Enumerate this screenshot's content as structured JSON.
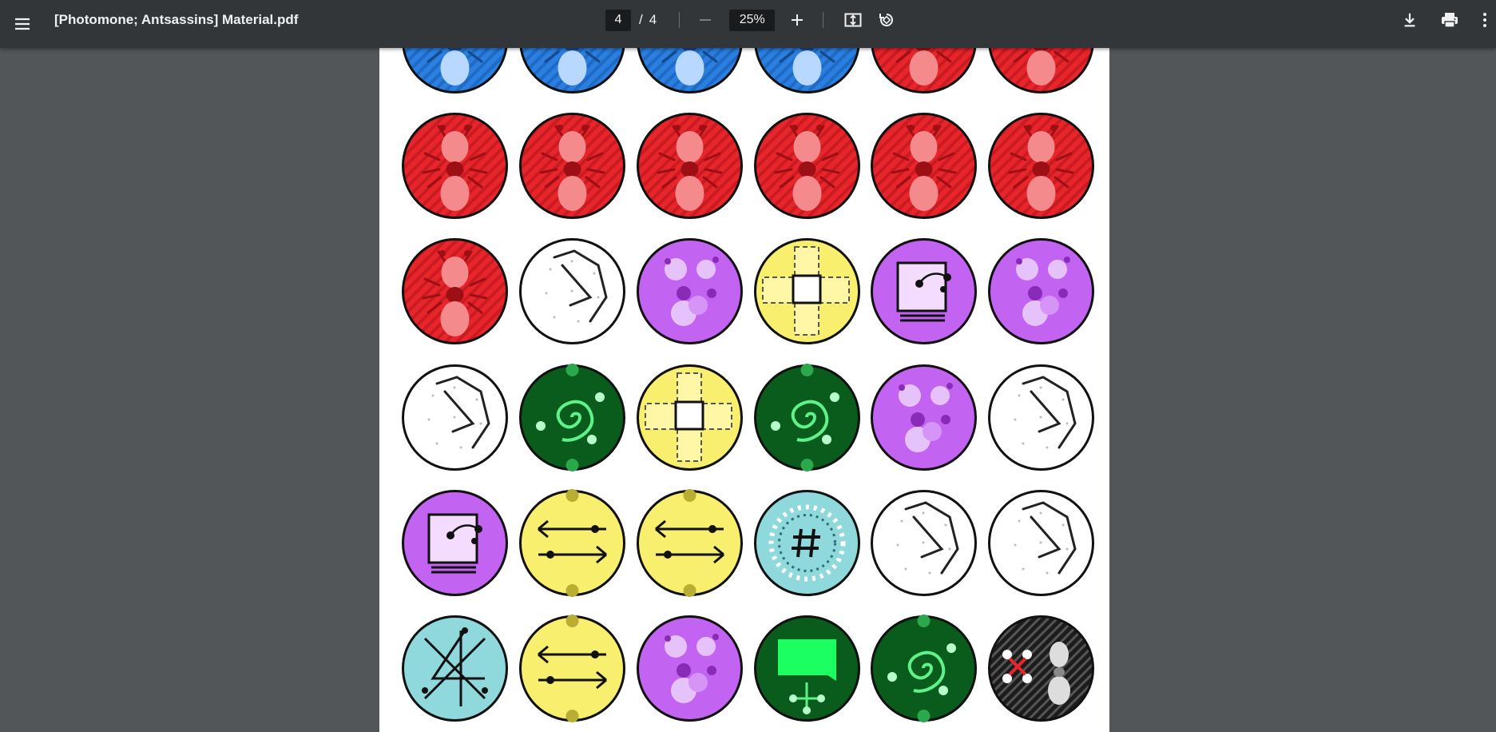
{
  "toolbar": {
    "title": "[Photomone; Antsassins] Material.pdf",
    "page_current": "4",
    "page_separator": "/",
    "page_total": "4",
    "zoom": "25%"
  },
  "icons": {
    "menu": "hamburger-menu-icon",
    "zoom_out": "minus-icon",
    "zoom_in": "plus-icon",
    "fit": "fit-to-page-icon",
    "rotate": "rotate-icon",
    "download": "download-icon",
    "print": "print-icon",
    "more": "more-vertical-icon"
  },
  "colors": {
    "toolbar_bg": "#323639",
    "viewer_bg": "#525659",
    "red_token": "#e8252b",
    "blue_token": "#2a7fe0",
    "purple_token": "#c263f2",
    "yellow_token": "#f8ef6e",
    "green_token": "#0a5c1c",
    "cyan_token": "#8fd8dc",
    "white_token": "#ffffff",
    "black_token": "#2a2a2a"
  },
  "tokens": [
    [
      "blue-ant",
      "blue-ant",
      "blue-ant",
      "blue-ant",
      "red-ant",
      "red-ant"
    ],
    [
      "red-ant",
      "red-ant",
      "red-ant",
      "red-ant",
      "red-ant",
      "red-ant"
    ],
    [
      "red-ant",
      "white-lines",
      "purple-ants",
      "yellow-cross",
      "purple-card",
      "purple-ants"
    ],
    [
      "white-lines",
      "green-spiral",
      "yellow-cross",
      "green-spiral",
      "purple-ants",
      "white-lines"
    ],
    [
      "purple-card",
      "yellow-arrows",
      "yellow-arrows",
      "cyan-hash",
      "white-lines",
      "white-lines"
    ],
    [
      "cyan-star",
      "yellow-arrows",
      "purple-ants",
      "green-speech",
      "green-spiral",
      "black-x-ant"
    ]
  ]
}
